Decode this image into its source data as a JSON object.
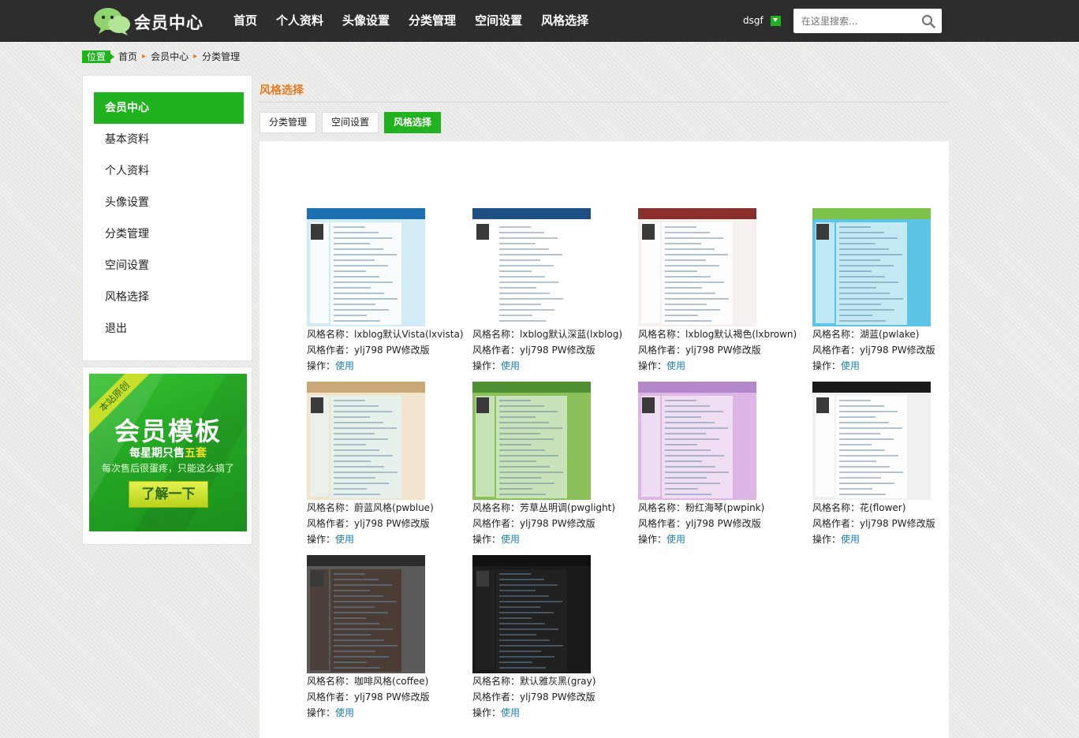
{
  "header": {
    "logo_text": "会员中心",
    "nav": [
      "首页",
      "个人资料",
      "头像设置",
      "分类管理",
      "空间设置",
      "风格选择"
    ],
    "username": "dsgf",
    "search_placeholder": "在这里搜索..."
  },
  "breadcrumb": {
    "tag": "位置",
    "items": [
      "首页",
      "会员中心",
      "分类管理"
    ]
  },
  "sidebar": {
    "items": [
      {
        "label": "会员中心",
        "active": true
      },
      {
        "label": "基本资料"
      },
      {
        "label": "个人资料"
      },
      {
        "label": "头像设置"
      },
      {
        "label": "分类管理"
      },
      {
        "label": "空间设置"
      },
      {
        "label": "风格选择"
      },
      {
        "label": "退出"
      }
    ]
  },
  "promo": {
    "ribbon": "本站原创",
    "title": "会员模板",
    "sub_prefix": "每星期只售",
    "sub_highlight": "五套",
    "line": "每次售后很蛋疼，只能这么搞了",
    "button": "了解一下"
  },
  "main": {
    "title": "风格选择",
    "tabs": [
      {
        "label": "分类管理"
      },
      {
        "label": "空间设置"
      },
      {
        "label": "风格选择",
        "active": true
      }
    ],
    "name_prefix": "风格名称：",
    "author_prefix": "风格作者：",
    "action_prefix": "操作：",
    "themes": [
      {
        "name": "lxblog默认Vista(lxvista)",
        "author": "ylj798 PW修改版",
        "action": "使用",
        "colors": [
          "#1c6fb1",
          "#ffffff",
          "#d2ecf7"
        ]
      },
      {
        "name": "lxblog默认深蓝(lxblog)",
        "author": "ylj798 PW修改版",
        "action": "使用",
        "colors": [
          "#1e4f82",
          "#ffffff",
          "#ffffff"
        ]
      },
      {
        "name": "lxblog默认褐色(lxbrown)",
        "author": "ylj798 PW修改版",
        "action": "使用",
        "colors": [
          "#8a2f2b",
          "#ffffff",
          "#f6f0ee"
        ]
      },
      {
        "name": "湖蓝(pwlake)",
        "author": "ylj798 PW修改版",
        "action": "使用",
        "colors": [
          "#7cc24a",
          "#cfeff5",
          "#5ec4e6"
        ]
      },
      {
        "name": "蔚蓝风格(pwblue)",
        "author": "ylj798 PW修改版",
        "action": "使用",
        "colors": [
          "#c9a875",
          "#e7f3ef",
          "#f0e5cc"
        ]
      },
      {
        "name": "芳草丛明调(pwglight)",
        "author": "ylj798 PW修改版",
        "action": "使用",
        "colors": [
          "#4e8f33",
          "#cfe7c4",
          "#8cc05a"
        ]
      },
      {
        "name": "粉红海琴(pwpink)",
        "author": "ylj798 PW修改版",
        "action": "使用",
        "colors": [
          "#b387c9",
          "#f1e3f3",
          "#ddb6e6"
        ]
      },
      {
        "name": "花(flower)",
        "author": "ylj798 PW修改版",
        "action": "使用",
        "colors": [
          "#1a1a1a",
          "#ffffff",
          "#f0f0f0"
        ]
      },
      {
        "name": "咖啡风格(coffee)",
        "author": "ylj798 PW修改版",
        "action": "使用",
        "colors": [
          "#2c2c2c",
          "#4a3a32",
          "#5a5a5a"
        ]
      },
      {
        "name": "默认雅灰黑(gray)",
        "author": "ylj798 PW修改版",
        "action": "使用",
        "colors": [
          "#111111",
          "#222222",
          "#1a1a1a"
        ]
      }
    ]
  }
}
